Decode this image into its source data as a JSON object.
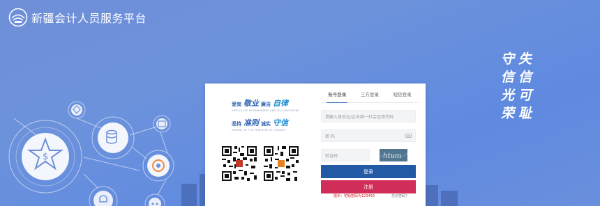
{
  "header": {
    "site_title": "新疆会计人员服务平台"
  },
  "slogan": {
    "columns": [
      [
        "失",
        "信",
        "可",
        "耻"
      ],
      [
        "守",
        "信",
        "光",
        "荣"
      ]
    ]
  },
  "motto": {
    "line1": {
      "small_a": "爱岗",
      "big_a": "敬业",
      "small_b": "廉洁",
      "big_b": "自律"
    },
    "line1_sub": "ARTICULATE WORKMANSHIP AND SELF-DISCIPLINE",
    "line2": {
      "small_a": "坚持",
      "big_a": "准则",
      "small_b": "诚实",
      "big_b": "守信"
    },
    "line2_sub": "ADHERE TO THE PRINCIPLE OF HONESTY"
  },
  "login": {
    "tabs": [
      {
        "label": "账号登录",
        "active": true
      },
      {
        "label": "三方登录",
        "active": false
      },
      {
        "label": "短信登录",
        "active": false
      }
    ],
    "id_placeholder": "请输入身份证/企业统一社会信用代码",
    "password_placeholder": "密 码",
    "captcha_placeholder": "验证码",
    "captcha_text": "htum",
    "login_button": "登录",
    "register_button": "注册",
    "hint": "提示：初始密码为123456",
    "forgot_link": "忘记密码？"
  },
  "colors": {
    "primary": "#235aa6",
    "danger": "#d02d59",
    "background": "#6a8fdd"
  }
}
